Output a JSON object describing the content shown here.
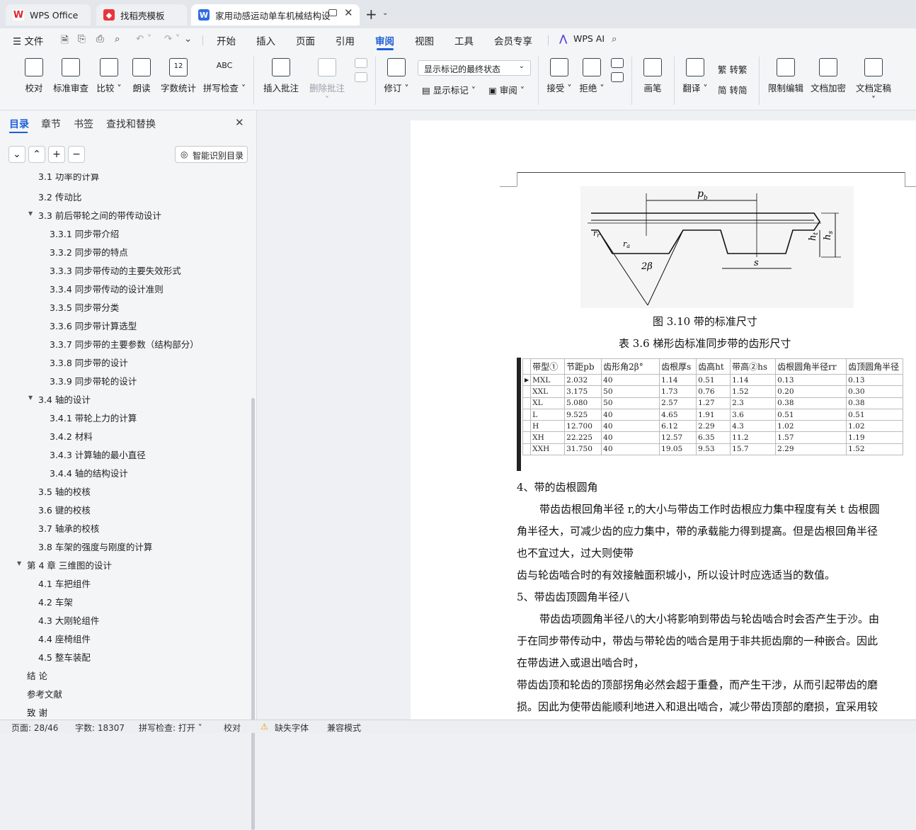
{
  "tabs": [
    {
      "label": "WPS Office",
      "icon": "wps-logo-icon"
    },
    {
      "label": "找稻壳模板",
      "icon": "docer-icon"
    },
    {
      "label": "家用动感运动单车机械结构设",
      "icon": "word-doc-icon"
    }
  ],
  "menu": {
    "file": "文件",
    "items": [
      "开始",
      "插入",
      "页面",
      "引用",
      "审阅",
      "视图",
      "工具",
      "会员专享"
    ],
    "active": "审阅",
    "ai": "WPS AI"
  },
  "ribbon": {
    "proofread": "校对",
    "std_review": "标准审查",
    "compare": "比较",
    "read_aloud": "朗读",
    "word_count": "字数统计",
    "spell_check": "拼写检查",
    "insert_comment": "插入批注",
    "delete_comment": "删除批注",
    "track": "修订",
    "markup_state": "显示标记的最终状态",
    "show_markup": "显示标记",
    "review": "审阅",
    "accept": "接受",
    "reject": "拒绝",
    "pen": "画笔",
    "translate": "翻译",
    "to_traditional": "转繁",
    "to_simplified": "转简",
    "restrict_edit": "限制编辑",
    "encrypt": "文档加密",
    "finalize": "文档定稿"
  },
  "panel": {
    "tabs": [
      "目录",
      "章节",
      "书签",
      "查找和替换"
    ],
    "active": "目录",
    "smart_toc": "智能识别目录"
  },
  "toc": [
    {
      "t": "3.1 功率的计算",
      "l": 2
    },
    {
      "t": "3.2 传动比",
      "l": 2
    },
    {
      "t": "3.3 前后带轮之间的带传动设计",
      "l": 2,
      "a": true
    },
    {
      "t": "3.3.1 同步带介绍",
      "l": 3
    },
    {
      "t": "3.3.2 同步带的特点",
      "l": 3
    },
    {
      "t": "3.3.3 同步带传动的主要失效形式",
      "l": 3
    },
    {
      "t": "3.3.4 同步带传动的设计准则",
      "l": 3
    },
    {
      "t": "3.3.5 同步带分类",
      "l": 3
    },
    {
      "t": "3.3.6 同步带计算选型",
      "l": 3
    },
    {
      "t": "3.3.7 同步带的主要参数（结构部分）",
      "l": 3
    },
    {
      "t": "3.3.8 同步带的设计",
      "l": 3
    },
    {
      "t": "3.3.9 同步带轮的设计",
      "l": 3
    },
    {
      "t": "3.4 轴的设计",
      "l": 2,
      "a": true
    },
    {
      "t": "3.4.1 带轮上力的计算",
      "l": 3
    },
    {
      "t": "3.4.2 材料",
      "l": 3
    },
    {
      "t": "3.4.3 计算轴的最小直径",
      "l": 3
    },
    {
      "t": "3.4.4 轴的结构设计",
      "l": 3
    },
    {
      "t": "3.5 轴的校核",
      "l": 2
    },
    {
      "t": "3.6 键的校核",
      "l": 2
    },
    {
      "t": "3.7 轴承的校核",
      "l": 2
    },
    {
      "t": "3.8 车架的强度与刚度的计算",
      "l": 2
    },
    {
      "t": "第 4 章 三维图的设计",
      "l": 1,
      "a": true
    },
    {
      "t": "4.1 车把组件",
      "l": 2
    },
    {
      "t": "4.2 车架",
      "l": 2
    },
    {
      "t": "4.3 大刚轮组件",
      "l": 2
    },
    {
      "t": "4.4 座椅组件",
      "l": 2
    },
    {
      "t": "4.5 整车装配",
      "l": 2
    },
    {
      "t": "结 论",
      "l": 1
    },
    {
      "t": "参考文献",
      "l": 1
    },
    {
      "t": "致 谢",
      "l": 1
    }
  ],
  "doc": {
    "fig_labels": {
      "pb": "p",
      "pb_sub": "b",
      "s": "s",
      "two_beta": "2β",
      "hs": "h",
      "hs_sub": "s",
      "ht": "h",
      "ht_sub": "t",
      "rr": "r",
      "rr_sub": "r",
      "ra": "r",
      "ra_sub": "a"
    },
    "fig_caption": "图 3.10   带的标准尺寸",
    "table_caption": "表 3.6 梯形齿标准同步带的齿形尺寸",
    "table": {
      "headers": [
        "带型①",
        "节距pb",
        "齿形角2β°",
        "齿根厚s",
        "齿高ht",
        "带高②hs",
        "齿根圆角半径rr",
        "齿顶圆角半径"
      ],
      "rows": [
        [
          "MXL",
          "2.032",
          "40",
          "1.14",
          "0.51",
          "1.14",
          "0.13",
          "0.13"
        ],
        [
          "XXL",
          "3.175",
          "50",
          "1.73",
          "0.76",
          "1.52",
          "0.20",
          "0.30"
        ],
        [
          "XL",
          "5.080",
          "50",
          "2.57",
          "1.27",
          "2.3",
          "0.38",
          "0.38"
        ],
        [
          "L",
          "9.525",
          "40",
          "4.65",
          "1.91",
          "3.6",
          "0.51",
          "0.51"
        ],
        [
          "H",
          "12.700",
          "40",
          "6.12",
          "2.29",
          "4.3",
          "1.02",
          "1.02"
        ],
        [
          "XH",
          "22.225",
          "40",
          "12.57",
          "6.35",
          "11.2",
          "1.57",
          "1.19"
        ],
        [
          "XXH",
          "31.750",
          "40",
          "19.05",
          "9.53",
          "15.7",
          "2.29",
          "1.52"
        ]
      ]
    },
    "lines": [
      "4、带的齿根圆角",
      "带齿齿根回角半径 r,的大小与带齿工作时齿根应力集中程度有关 t 齿根圆",
      "角半径大，可减少齿的应力集中，带的承载能力得到提高。但是齿根回角半径",
      "也不宜过大，过大则使带",
      "齿与轮齿啮合时的有效接触面积城小，所以设计时应选适当的数值。",
      "5、带齿齿顶圆角半径八",
      "带齿齿项圆角半径八的大小将影响到带齿与轮齿啮合时会否产生于沙。由",
      "于在同步带传动中，带齿与带轮齿的啮合是用于非共扼齿廓的一种嵌合。因此",
      "在带齿进入或退出啮合时，",
      "带齿齿顶和轮齿的顶部拐角必然会超于重叠，而产生干涉，从而引起带齿的磨",
      "损。因此为使带齿能顺利地进入和退出啮合，减少带齿顶部的磨损，宜采用较"
    ]
  },
  "status": {
    "page": "页面: 28/46",
    "words": "字数: 18307",
    "spell": "拼写检查: 打开",
    "proof": "校对",
    "missing_font": "缺失字体",
    "compat": "兼容模式"
  }
}
